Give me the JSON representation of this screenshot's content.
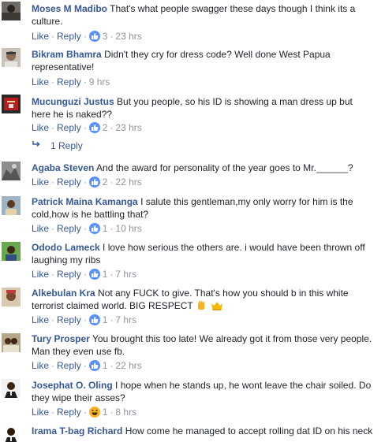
{
  "labels": {
    "like": "Like",
    "reply": "Reply"
  },
  "colors": {
    "author": "#365899",
    "meta": "#90949c",
    "like_reaction": "#5890ff",
    "haha_reaction": "#f7b125"
  },
  "comments": [
    {
      "author": "Moses M Madibo",
      "text": "That's what people swagger these days though I think its a culture.",
      "reaction_count": "3",
      "reaction": "like",
      "time": "23 hrs"
    },
    {
      "author": "Bikram Bhamra",
      "text": "Didn't they cry for dress code? Well done West Papua representative!",
      "time": "9 hrs"
    },
    {
      "author": "Mucunguzi Justus",
      "text": "But you people, so his ID is showing a man dress up but here he is naked??",
      "reaction_count": "2",
      "reaction": "like",
      "time": "23 hrs"
    },
    {
      "author": "Agaba Steven",
      "text": "And the award for personality of the year goes to Mr.______?",
      "reaction_count": "2",
      "reaction": "like",
      "time": "22 hrs"
    },
    {
      "author": "Patrick Maina Kamanga",
      "text": "I salute this gentleman,my only worry for him is the cold,how is he battling that?",
      "reaction_count": "1",
      "reaction": "like",
      "time": "10 hrs"
    },
    {
      "author": "Ododo Lameck",
      "text": "I love how serious the others are. i would have been thrown off laughing my ribs",
      "reaction_count": "1",
      "reaction": "like",
      "time": "7 hrs"
    },
    {
      "author": "Alkebulan Kra",
      "text": "Not any FUCK to give. That's how you should b in this white terrorist claimed world. BIG RESPECT",
      "emoji_icons": [
        "raised-fist-icon",
        "crown-icon"
      ],
      "reaction_count": "1",
      "reaction": "like",
      "time": "7 hrs"
    },
    {
      "author": "Tury Prosper",
      "text": "You brought this too late! We already got it from those very people. Man they even use fb.",
      "reaction_count": "1",
      "reaction": "like",
      "time": "22 hrs"
    },
    {
      "author": "Josephat O. Oling",
      "text": "I hope when he stands up, he wont leave the chair soiled. Do they wipe their asses?",
      "reaction_count": "1",
      "reaction": "haha",
      "time": "8 hrs"
    },
    {
      "author": "Irama T-bag Richard",
      "text": "How come he managed to accept rolling dat ID on his neck"
    }
  ],
  "replies_link": {
    "label": "1 Reply",
    "icon": "reply-arrow-icon"
  }
}
